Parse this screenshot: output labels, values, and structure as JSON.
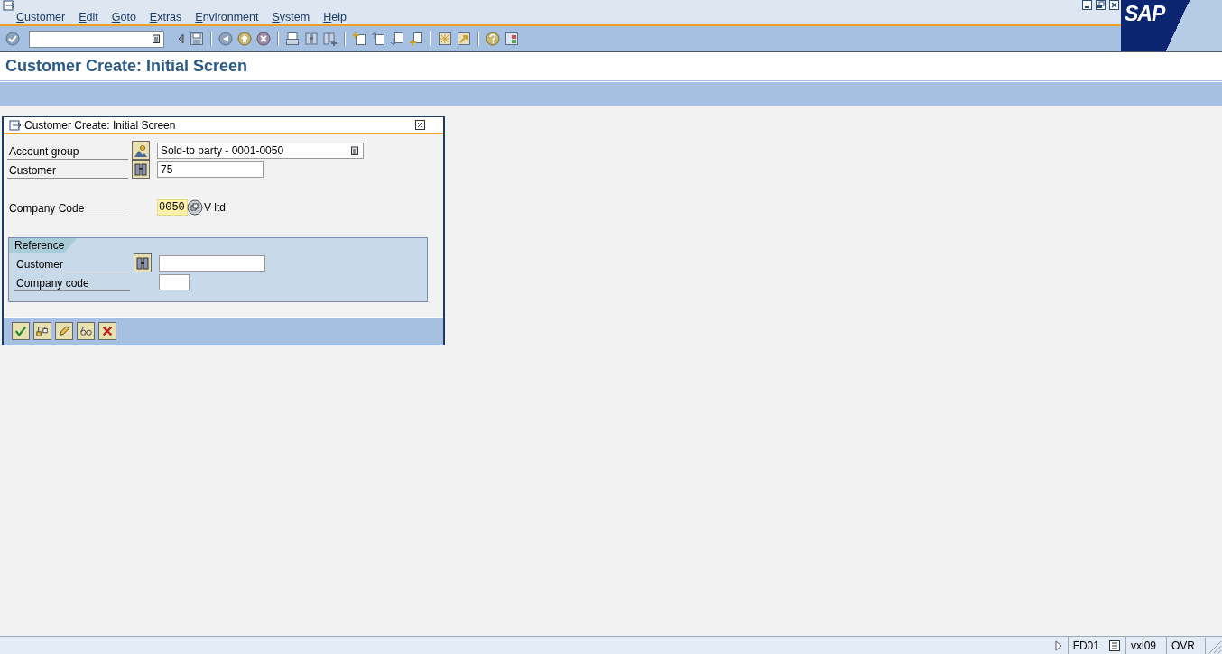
{
  "menu": [
    {
      "label": "Customer"
    },
    {
      "label": "Edit"
    },
    {
      "label": "Goto"
    },
    {
      "label": "Extras"
    },
    {
      "label": "Environment"
    },
    {
      "label": "System"
    },
    {
      "label": "Help"
    }
  ],
  "logo": "SAP",
  "page_title": "Customer Create: Initial Screen",
  "dialog": {
    "title": "Customer Create: Initial Screen",
    "fields": [
      {
        "label": "Account group",
        "kind": "dropdown",
        "value": "Sold-to party - 0001-0050"
      },
      {
        "label": "Customer",
        "kind": "search",
        "value": "75"
      },
      {
        "label": "Company Code",
        "kind": "help",
        "value": "0050",
        "description": "V ltd"
      }
    ],
    "reference": {
      "title": "Reference",
      "fields": [
        {
          "label": "Customer",
          "kind": "search"
        },
        {
          "label": "Company code",
          "kind": "short"
        }
      ]
    }
  },
  "status_bar": {
    "transaction": "FD01",
    "server": "vxl09",
    "mode": "OVR"
  }
}
